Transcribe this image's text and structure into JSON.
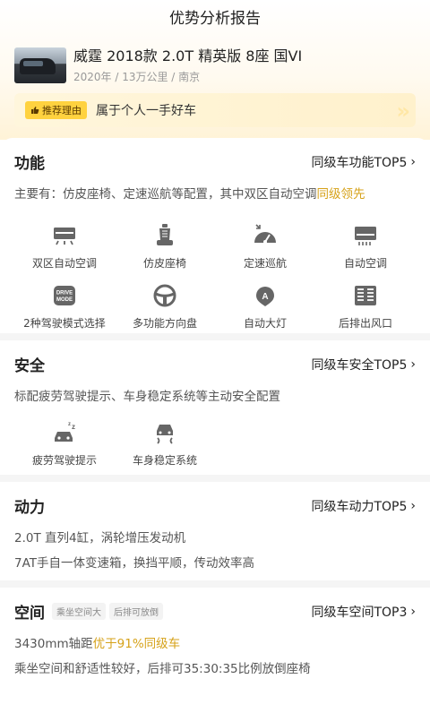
{
  "header": {
    "title": "优势分析报告"
  },
  "car": {
    "name": "威霆 2018款 2.0T 精英版 8座 国VI",
    "meta": "2020年 / 13万公里 / 南京"
  },
  "reason": {
    "tag": "推荐理由",
    "text": "属于个人一手好车"
  },
  "function": {
    "title": "功能",
    "link": "同级车功能TOP5",
    "desc_prefix": "主要有：仿皮座椅、定速巡航等配置，其中双区自动空调",
    "desc_highlight": "同级领先",
    "features": [
      {
        "label": "双区自动空调",
        "icon": "dual-zone-ac-icon"
      },
      {
        "label": "仿皮座椅",
        "icon": "leather-seat-icon"
      },
      {
        "label": "定速巡航",
        "icon": "cruise-control-icon"
      },
      {
        "label": "自动空调",
        "icon": "auto-ac-icon"
      },
      {
        "label": "2种驾驶模式选择",
        "icon": "drive-mode-icon"
      },
      {
        "label": "多功能方向盘",
        "icon": "steering-wheel-icon"
      },
      {
        "label": "自动大灯",
        "icon": "auto-headlight-icon"
      },
      {
        "label": "后排出风口",
        "icon": "rear-vent-icon"
      }
    ],
    "drive_mode_text": "DRIVE MODE",
    "headlight_text": "A"
  },
  "safety": {
    "title": "安全",
    "link": "同级车安全TOP5",
    "desc": "标配疲劳驾驶提示、车身稳定系统等主动安全配置",
    "features": [
      {
        "label": "疲劳驾驶提示",
        "icon": "fatigue-alert-icon"
      },
      {
        "label": "车身稳定系统",
        "icon": "stability-control-icon"
      }
    ]
  },
  "power": {
    "title": "动力",
    "link": "同级车动力TOP5",
    "line1": "2.0T 直列4缸，涡轮增压发动机",
    "line2": "7AT手自一体变速箱，换挡平顺，传动效率高"
  },
  "space": {
    "title": "空间",
    "tags": [
      "乘坐空间大",
      "后排可放倒"
    ],
    "link": "同级车空间TOP3",
    "line1_prefix": "3430mm轴距",
    "line1_highlight": "优于91%同级车",
    "line2": "乘坐空间和舒适性较好，后排可35:30:35比例放倒座椅"
  },
  "colors": {
    "accent": "#d6a21a",
    "tag_bg": "#ffd23f"
  }
}
